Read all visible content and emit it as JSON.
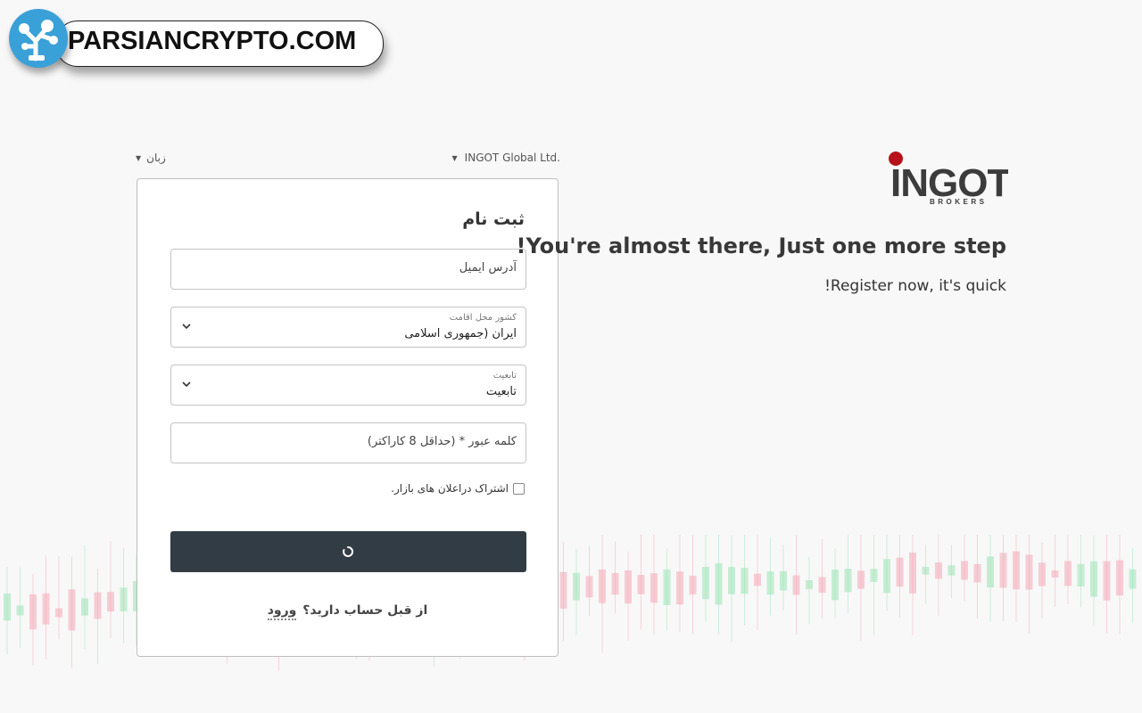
{
  "watermark": {
    "text": "PARSIANCRYPTO.COM"
  },
  "top": {
    "language_label": "زبان",
    "entity_label": "INGOT Global Ltd."
  },
  "brand": {
    "logo_text": "INGOT",
    "logo_subtext": "BROKERS",
    "accent": "#b5121b"
  },
  "form": {
    "title": "ثبت نام",
    "email_placeholder": "آدرس ایمیل",
    "country": {
      "label": "کشور محل اقامت",
      "value": "ایران (جمهوری اسلامی"
    },
    "nationality": {
      "label": "تابعیت",
      "value": "تابعیت"
    },
    "password_placeholder": "کلمه عبور * (حداقل 8 کاراکتر)",
    "subscribe_label": "اشتراک دراعلان های بازار.",
    "login_prompt": "از قبل حساب دارید؟",
    "login_link": "ورود",
    "button_color": "#323c45"
  },
  "promo": {
    "headline": "!You're almost there, Just one more step",
    "subline": "!Register now, it's quick"
  },
  "icons": {
    "lang_caret": "caret-down-icon",
    "entity_caret": "caret-down-icon",
    "select_chevron": "chevron-down-icon",
    "spinner": "loading-spinner-icon"
  }
}
